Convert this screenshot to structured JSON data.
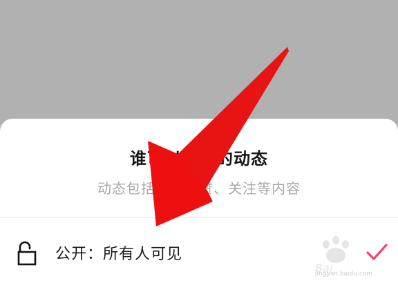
{
  "sheet": {
    "title": "谁可以看我的动态",
    "subtitle": "动态包括你的点赞、关注等内容"
  },
  "option": {
    "label": "公开：所有人可见",
    "icon": "unlock-icon",
    "selected": true
  },
  "watermark": {
    "logo": "Baidu经验",
    "url": "jingyan.baidu.com"
  },
  "colors": {
    "overlay": "#b1b1b1",
    "sheet": "#ffffff",
    "title": "#161616",
    "subtitle": "#a8a8a8",
    "check": "#f0456a",
    "arrow": "#ee1010"
  }
}
